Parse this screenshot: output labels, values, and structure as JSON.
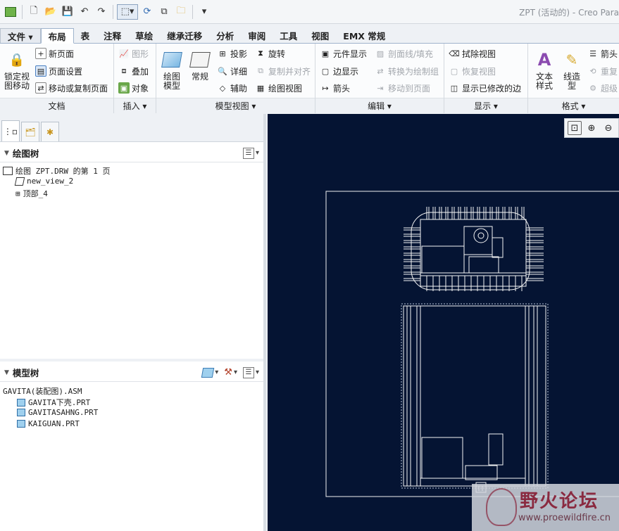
{
  "window": {
    "title": "ZPT (活动的) - Creo Para"
  },
  "tabs": [
    {
      "label": "文件 ▾"
    },
    {
      "label": "布局"
    },
    {
      "label": "表"
    },
    {
      "label": "注释"
    },
    {
      "label": "草绘"
    },
    {
      "label": "继承迁移"
    },
    {
      "label": "分析"
    },
    {
      "label": "审阅"
    },
    {
      "label": "工具"
    },
    {
      "label": "视图"
    },
    {
      "label": "EMX 常规"
    }
  ],
  "ribbon": {
    "doc": {
      "lock_label": "锁定视图移动",
      "new_page": "新页面",
      "page_setup": "页面设置",
      "move_copy": "移动或复制页面",
      "group": "文档"
    },
    "insert": {
      "graphic": "图形",
      "overlay": "叠加",
      "object": "对象",
      "group": "插入 ▾"
    },
    "model_views": {
      "drawing_model": "绘图模型",
      "general": "常规",
      "projection": "投影",
      "detail": "详细",
      "auxiliary": "辅助",
      "revolve": "旋转",
      "copy_align": "复制并对齐",
      "drawing_view": "绘图视图",
      "group": "模型视图 ▾"
    },
    "edit": {
      "component_display": "元件显示",
      "section_fill": "剖面线/填充",
      "edge_display": "边显示",
      "convert_draft": "转换为绘制组",
      "arrow": "箭头",
      "move_to_page": "移动到页面",
      "group": "编辑 ▾"
    },
    "display": {
      "erase_view": "拭除视图",
      "restore_view": "恢复视图",
      "show_modified_edges": "显示已修改的边",
      "group": "显示 ▾"
    },
    "format": {
      "text_style": "文本样式",
      "line_style": "线造型",
      "arrow": "箭头",
      "repeat": "重复",
      "hyperlink": "超级",
      "group": "格式 ▾"
    }
  },
  "drawing_tree": {
    "title": "绘图树",
    "items": [
      "绘图 ZPT.DRW 的第 1 页",
      "new_view_2",
      "顶部_4"
    ]
  },
  "model_tree": {
    "title": "模型树",
    "items": [
      "GAVITA(装配图).ASM",
      "GAVITA下壳.PRT",
      "GAVITASAHNG.PRT",
      "KAIGUAN.PRT"
    ]
  },
  "watermark": {
    "title": "野火论坛",
    "url": "www.proewildfire.cn"
  }
}
